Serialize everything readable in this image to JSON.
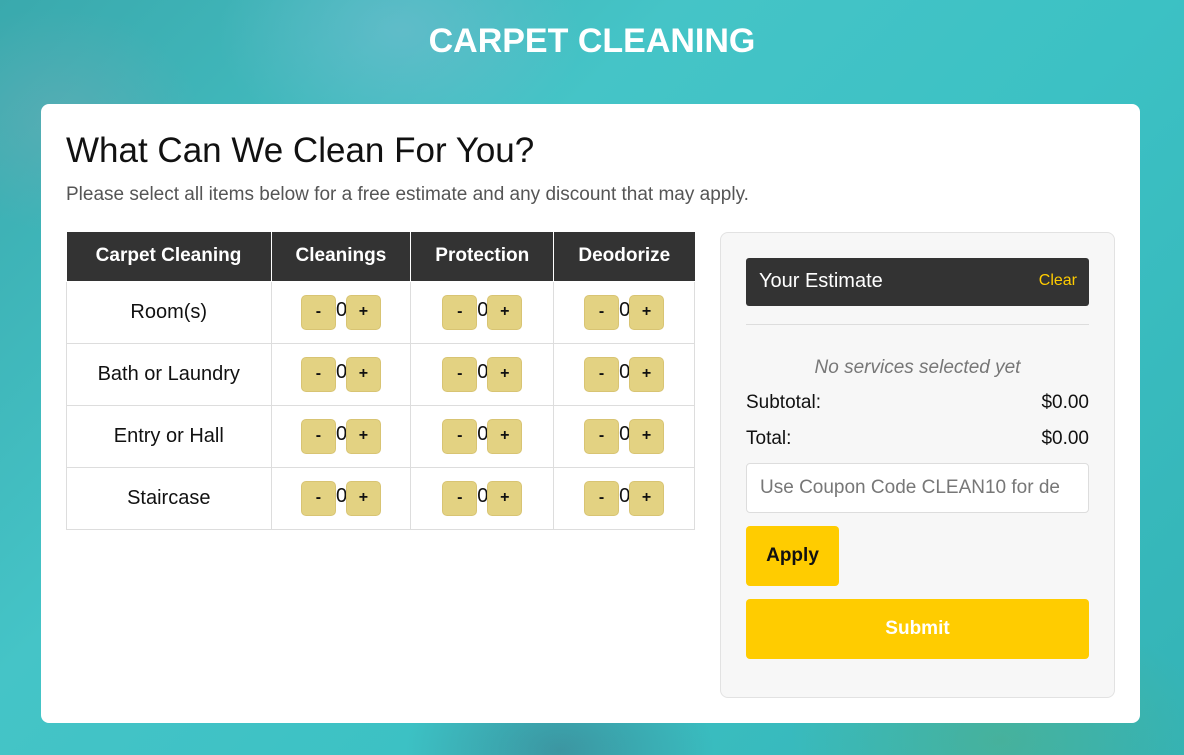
{
  "page_title": "CARPET CLEANING",
  "form": {
    "heading": "What Can We Clean For You?",
    "subheading": "Please select all items below for a free estimate and any discount that may apply."
  },
  "table": {
    "headers": [
      "Carpet Cleaning",
      "Cleanings",
      "Protection",
      "Deodorize"
    ],
    "rows": [
      {
        "label": "Room(s)",
        "values": [
          "0",
          "0",
          "0"
        ]
      },
      {
        "label": "Bath or Laundry",
        "values": [
          "0",
          "0",
          "0"
        ]
      },
      {
        "label": "Entry or Hall",
        "values": [
          "0",
          "0",
          "0"
        ]
      },
      {
        "label": "Staircase",
        "values": [
          "0",
          "0",
          "0"
        ]
      }
    ],
    "minus_label": "-",
    "plus_label": "+"
  },
  "estimate": {
    "title": "Your Estimate",
    "clear_label": "Clear",
    "empty_message": "No services selected yet",
    "subtotal_label": "Subtotal:",
    "subtotal_value": "$0.00",
    "total_label": "Total:",
    "total_value": "$0.00",
    "coupon_placeholder": "Use Coupon Code CLEAN10 for de",
    "apply_label": "Apply",
    "submit_label": "Submit"
  },
  "colors": {
    "accent": "#ffcc00",
    "stepper": "#e3d282",
    "header_dark": "#333333",
    "background": "#3cc1c4"
  }
}
